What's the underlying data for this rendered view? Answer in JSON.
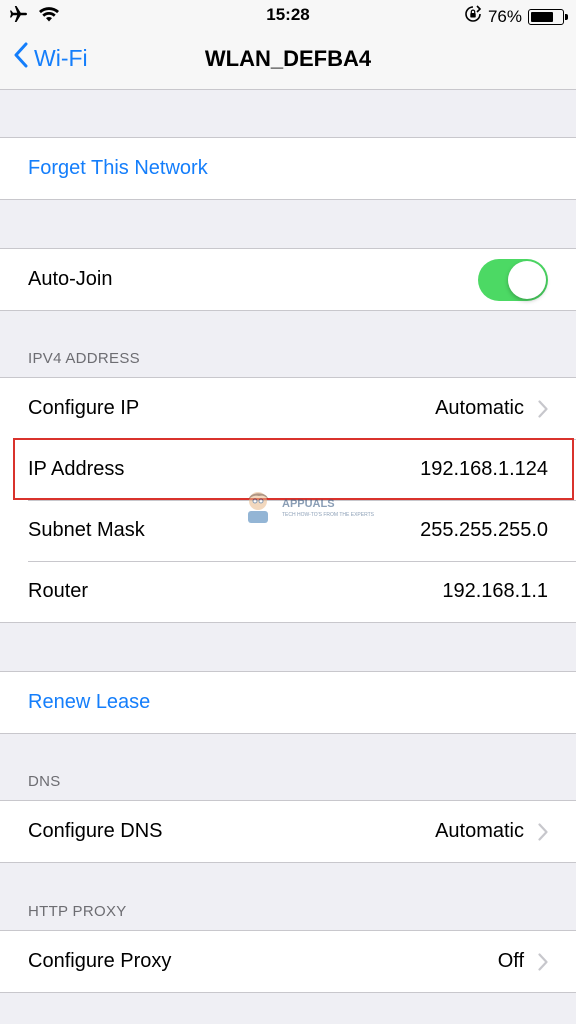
{
  "status_bar": {
    "time": "15:28",
    "battery": "76%",
    "battery_level": 0.76,
    "icons": [
      "airplane-icon",
      "wifi-icon",
      "orientation-lock-icon",
      "battery-icon"
    ]
  },
  "nav": {
    "back_label": "Wi-Fi",
    "title": "WLAN_DEFBA4"
  },
  "forget": {
    "label": "Forget This Network"
  },
  "auto_join": {
    "label": "Auto-Join",
    "enabled": true
  },
  "ipv4": {
    "header": "IPV4 ADDRESS",
    "configure_ip": {
      "label": "Configure IP",
      "value": "Automatic"
    },
    "ip_address": {
      "label": "IP Address",
      "value": "192.168.1.124"
    },
    "subnet_mask": {
      "label": "Subnet Mask",
      "value": "255.255.255.0"
    },
    "router": {
      "label": "Router",
      "value": "192.168.1.1"
    }
  },
  "renew": {
    "label": "Renew Lease"
  },
  "dns": {
    "header": "DNS",
    "configure_dns": {
      "label": "Configure DNS",
      "value": "Automatic"
    }
  },
  "proxy": {
    "header": "HTTP PROXY",
    "configure_proxy": {
      "label": "Configure Proxy",
      "value": "Off"
    }
  },
  "watermark": {
    "brand": "APPUALS",
    "tagline": "TECH HOW-TO'S FROM THE EXPERTS"
  },
  "colors": {
    "accent": "#147efb",
    "toggle_on": "#4cd964",
    "highlight": "#d9322c",
    "background": "#efeff4"
  }
}
